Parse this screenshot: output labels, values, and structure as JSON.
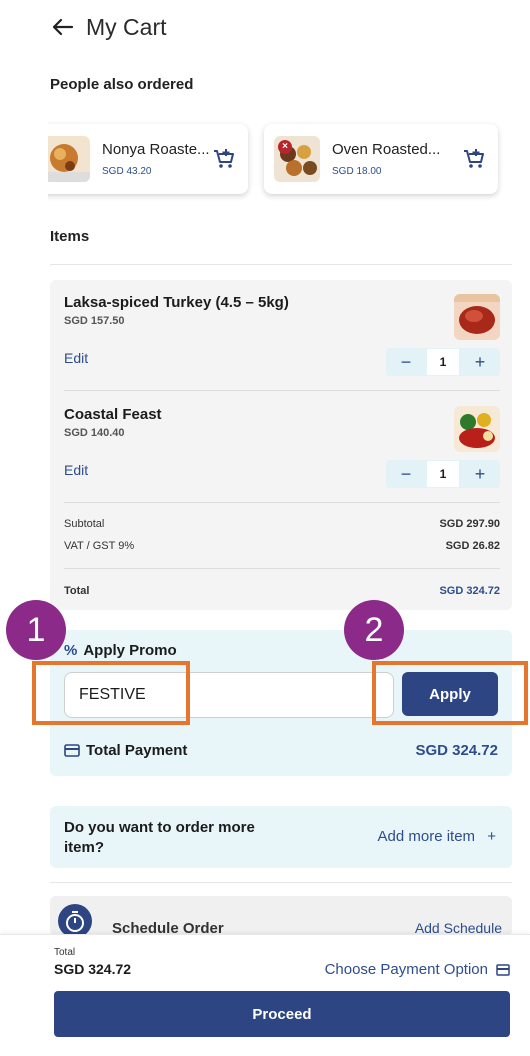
{
  "header": {
    "title": "My Cart"
  },
  "recommendations": {
    "title": "People also ordered",
    "items": [
      {
        "name": "Nonya Roaste...",
        "price": "SGD 43.20"
      },
      {
        "name": "Oven Roasted...",
        "price": "SGD 18.00"
      }
    ]
  },
  "items_section": {
    "title": "Items"
  },
  "cart": {
    "items": [
      {
        "name": "Laksa-spiced Turkey (4.5 – 5kg)",
        "price": "SGD 157.50",
        "edit": "Edit",
        "qty": "1"
      },
      {
        "name": "Coastal Feast",
        "price": "SGD 140.40",
        "edit": "Edit",
        "qty": "1"
      }
    ],
    "subtotal_label": "Subtotal",
    "subtotal_value": "SGD 297.90",
    "vat_label": "VAT / GST 9%",
    "vat_value": "SGD 26.82",
    "total_label": "Total",
    "total_value": "SGD 324.72"
  },
  "promo": {
    "title": "Apply Promo",
    "code": "FESTIVE",
    "apply_label": "Apply",
    "total_payment_label": "Total Payment",
    "total_payment_value": "SGD 324.72"
  },
  "more": {
    "question": "Do you want to order more item?",
    "link": "Add more item"
  },
  "schedule": {
    "label": "Schedule Order",
    "link": "Add Schedule"
  },
  "footer": {
    "total_label": "Total",
    "total_value": "SGD 324.72",
    "payment_option": "Choose Payment Option",
    "proceed": "Proceed"
  },
  "callouts": [
    "1",
    "2"
  ],
  "colors": {
    "primary": "#2d4583",
    "accent_link": "#2d4d8c",
    "callout": "#8b2a88",
    "highlight": "#e6762d",
    "promo_bg": "#e9f6f9"
  }
}
